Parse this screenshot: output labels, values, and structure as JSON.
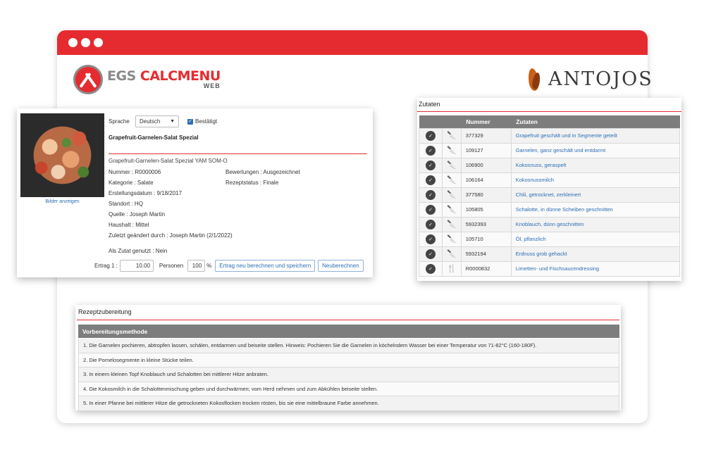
{
  "brand": {
    "egs_part1": "EGS ",
    "egs_part2": "CALCMENU",
    "egs_sub": "WEB",
    "antojos": "ANTOJOS"
  },
  "recipe": {
    "show_images": "Bilder anzeigen",
    "language_label": "Sprache",
    "language_value": "Deutsch",
    "confirmed_label": "Bestätigt",
    "title": "Grapefruit-Garnelen-Salat Spezial",
    "subtitle": "Grapefruit-Garnelen-Salat Spezial YAM SOM-O",
    "number": "Nummer : R0000006",
    "category": "Kategorie : Salate",
    "created": "Erstellungsdatum : 9/18/2017",
    "location": "Standort : HQ",
    "source": "Quelle : Joseph Martin",
    "budget": "Haushalt : Mittel",
    "modified": "Zuletzt geändert durch : Joseph Martin (2/1/2022)",
    "rating": "Bewertungen : Ausgezeichnet",
    "status": "Rezeptstatus : Finale",
    "used_as_ingredient": "Als Zutat genutzt : Nein",
    "yield_label": "Ertrag 1 :",
    "yield_value": "10.00",
    "persons_label": "Personen",
    "percent_value": "100",
    "percent_sign": "%",
    "recalc_save_button": "Ertrag neu berechnen und speichern",
    "recalc_button": "Neuberechnen"
  },
  "ingredients": {
    "title": "Zutaten",
    "columns": [
      "",
      "",
      "Nummer",
      "Zutaten"
    ],
    "rows": [
      {
        "number": "377329",
        "name": "Grapefruit geschält und in Segmente geteilt",
        "icon": "knife-icon"
      },
      {
        "number": "109127",
        "name": "Garnelen, ganz geschält und entdarmt",
        "icon": "knife-icon"
      },
      {
        "number": "106900",
        "name": "Kokosnuss, geraspelt",
        "icon": "knife-icon"
      },
      {
        "number": "106164",
        "name": "Kokosnussmilch",
        "icon": "knife-icon"
      },
      {
        "number": "377580",
        "name": "Chili, getrocknet, zerkleinert",
        "icon": "knife-icon"
      },
      {
        "number": "105805",
        "name": "Schalotte, in dünne Scheiben geschnitten",
        "icon": "knife-icon"
      },
      {
        "number": "5932393",
        "name": "Knoblauch, dünn geschnitten",
        "icon": "knife-icon"
      },
      {
        "number": "105710",
        "name": "Öl, pflanzlich",
        "icon": "knife-icon"
      },
      {
        "number": "5932194",
        "name": "Erdnuss grob gehackt",
        "icon": "knife-icon"
      },
      {
        "number": "R0000832",
        "name": "Limetten- und Fischsaucendressing",
        "icon": "fork-knife-icon"
      }
    ]
  },
  "preparation": {
    "title": "Rezeptzubereitung",
    "column": "Vorbereitungsmethode",
    "steps": [
      "1. Die Garnelen pochieren, abtropfen lassen, schälen, entdarmen und beiseite stellen. Hinweis: Pochieren Sie die Garnelen in köchelndem Wasser bei einer Temperatur von 71-82°C (160-180F).",
      "2. Die Pomelosegmente in kleine Stücke teilen.",
      "3. In einem kleinen Topf Knoblauch und Schalotten bei mittlerer Hitze anbraten.",
      "4. Die Kokosmilch in die Schalottenmischung geben und durchwärmen; vom Herd nehmen und zum Abkühlen beiseite stellen.",
      "5. In einer Pfanne bei mittlerer Hitze die getrockneten Kokosflocken trocken rösten, bis sie eine mittelbraune Farbe annehmen."
    ]
  },
  "colors": {
    "accent": "#e52b30",
    "link": "#2d6fb5",
    "table_header": "#7d7d7d"
  }
}
